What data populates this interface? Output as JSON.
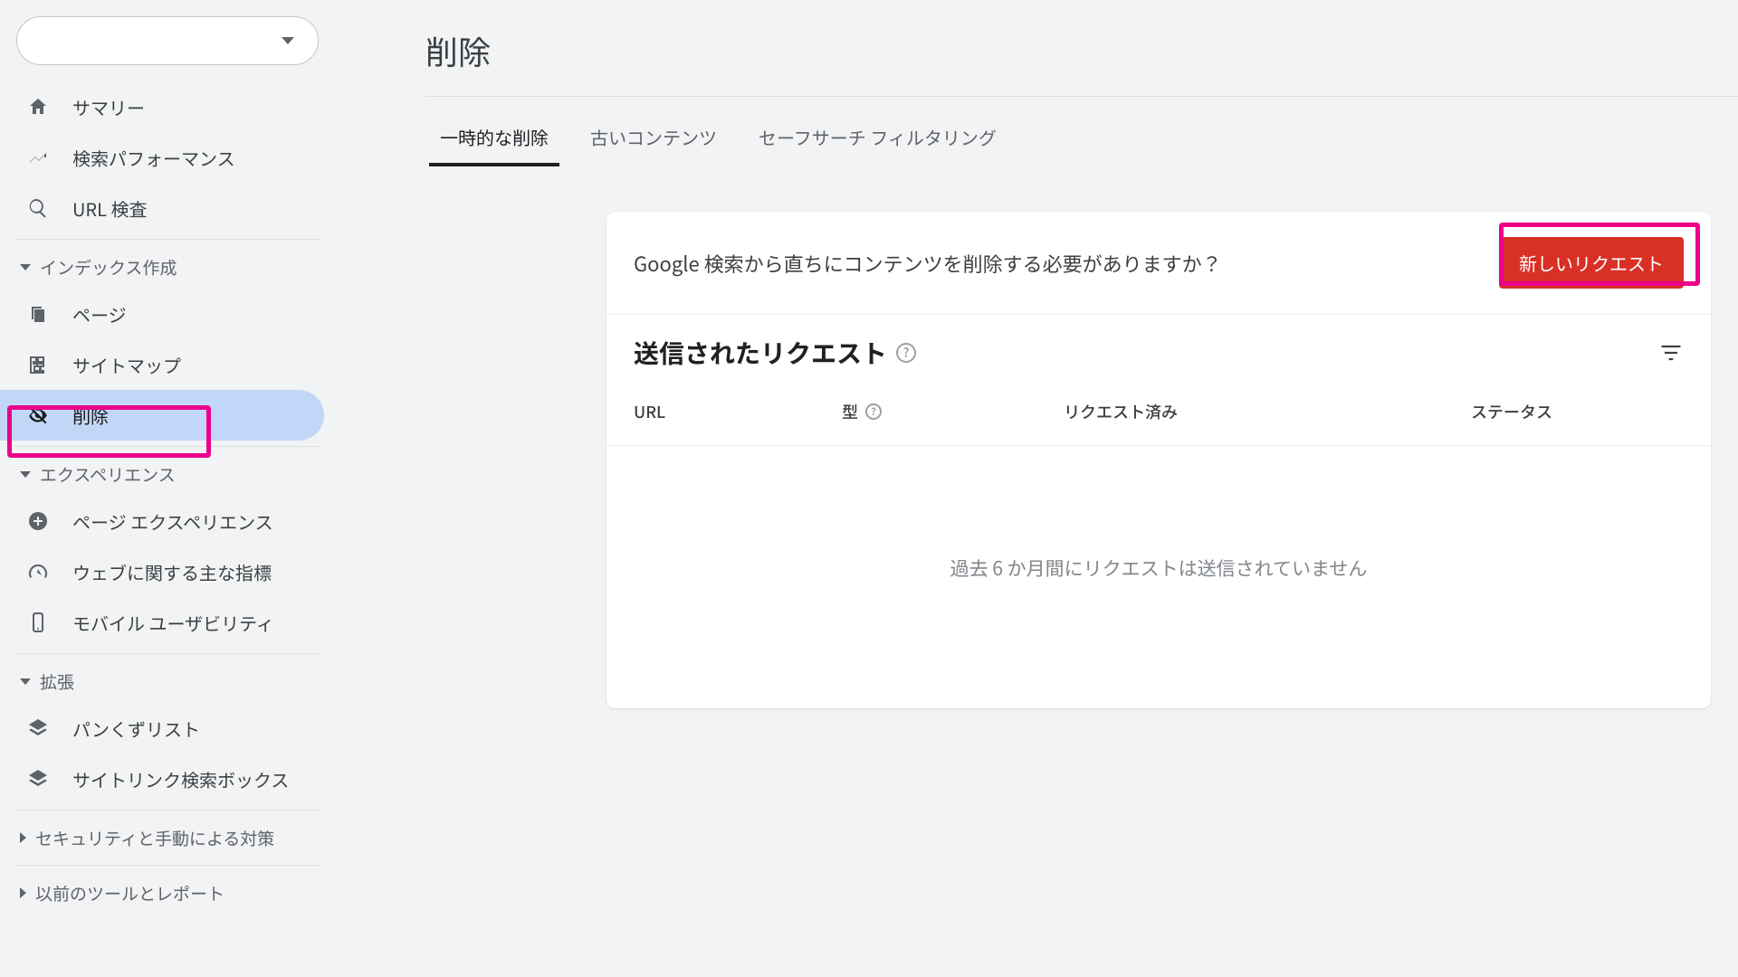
{
  "sidebar": {
    "property_selector": {
      "value": ""
    },
    "top": {
      "summary": "サマリー",
      "performance": "検索パフォーマンス",
      "url_inspect": "URL 検査"
    },
    "index_section": {
      "label": "インデックス作成",
      "pages": "ページ",
      "sitemaps": "サイトマップ",
      "removals": "削除"
    },
    "experience_section": {
      "label": "エクスペリエンス",
      "page_experience": "ページ エクスペリエンス",
      "core_vitals": "ウェブに関する主な指標",
      "mobile_usability": "モバイル ユーザビリティ"
    },
    "extension_section": {
      "label": "拡張",
      "breadcrumbs": "パンくずリスト",
      "sitelinks_search": "サイトリンク検索ボックス"
    },
    "security_section": {
      "label": "セキュリティと手動による対策"
    },
    "legacy_section": {
      "label": "以前のツールとレポート"
    }
  },
  "page_title": "削除",
  "tabs": {
    "temporary": "一時的な削除",
    "outdated": "古いコンテンツ",
    "safesearch": "セーフサーチ フィルタリング",
    "active_index": 0
  },
  "prompt": {
    "text": "Google 検索から直ちにコンテンツを削除する必要がありますか？",
    "button": "新しいリクエスト"
  },
  "requests": {
    "heading": "送信されたリクエスト",
    "columns": {
      "url": "URL",
      "type": "型",
      "requested": "リクエスト済み",
      "status": "ステータス"
    },
    "empty_message": "過去 6 か月間にリクエストは送信されていません"
  }
}
